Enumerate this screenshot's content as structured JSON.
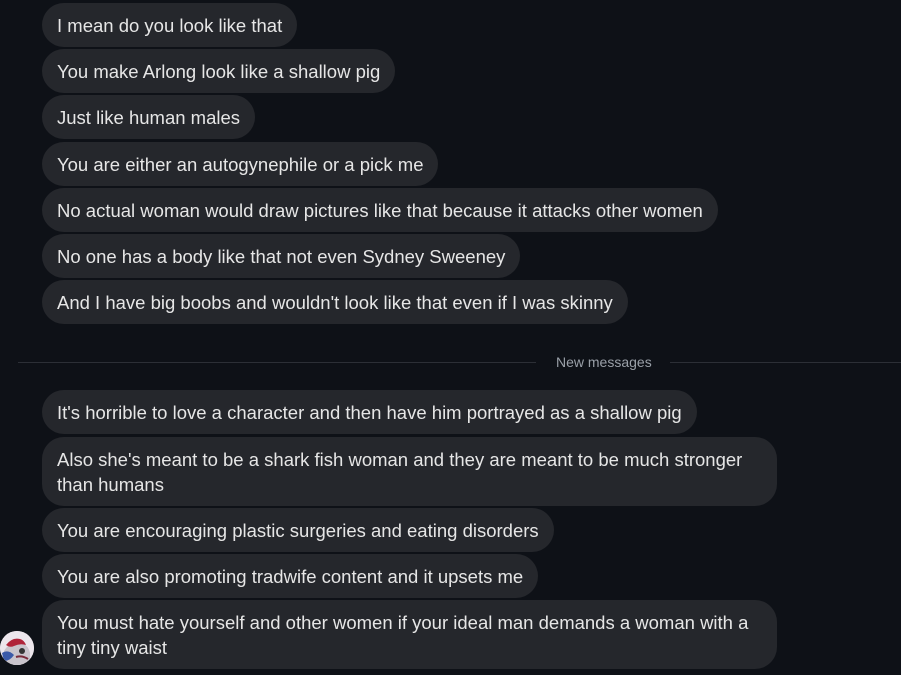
{
  "messages_before": [
    "I mean do you look like that",
    "You make Arlong look like a shallow pig",
    "Just like human males",
    "You are either an autogynephile or a pick me",
    "No actual woman would draw pictures like that because it attacks other women",
    "No one has a body like that not even Sydney Sweeney",
    "And I have big boobs and wouldn't look like that even if I was skinny"
  ],
  "divider": {
    "label": "New messages"
  },
  "messages_after": [
    "It's horrible to love a character and then have him portrayed as a shallow pig",
    "Also she's meant to be a shark fish woman and they are meant to be much stronger than humans",
    "You are encouraging plastic surgeries and eating disorders",
    "You are also promoting tradwife content and it upsets me",
    "You must hate yourself and other women if your ideal man demands a woman with a tiny tiny waist"
  ],
  "avatar": {
    "icon": "user-avatar-icon"
  },
  "colors": {
    "background": "#0e1117",
    "bubble": "#25272c",
    "text": "#e6e6e6",
    "divider_text": "#9aa0a8"
  }
}
